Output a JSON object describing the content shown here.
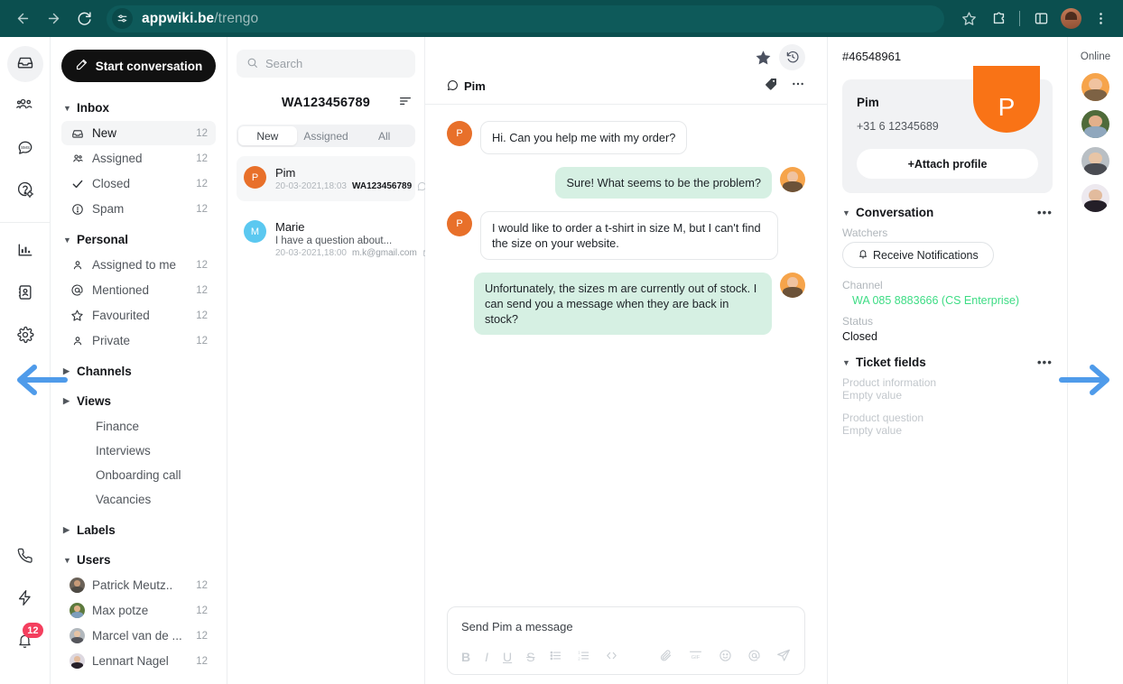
{
  "browser": {
    "url_host": "appwiki.be",
    "url_path": "/trengo",
    "back_icon": "back-arrow-icon",
    "forward_icon": "forward-arrow-icon",
    "reload_icon": "reload-icon",
    "site_settings_icon": "page-settings-icon",
    "bookmark_icon": "star-icon",
    "extensions_icon": "puzzle-icon",
    "sidepanel_icon": "side-panel-icon",
    "menu_icon": "three-dot-menu-icon"
  },
  "rail": {
    "items": [
      {
        "name": "inbox",
        "icon": "inbox-icon",
        "active": true
      },
      {
        "name": "teams",
        "icon": "users-group-icon",
        "active": false
      },
      {
        "name": "sms",
        "icon": "sms-bubble-icon",
        "active": false
      },
      {
        "name": "help-center",
        "icon": "help-gear-icon",
        "active": false
      },
      {
        "name": "reports",
        "icon": "bar-chart-icon",
        "active": false
      },
      {
        "name": "contacts",
        "icon": "contact-card-icon",
        "active": false
      },
      {
        "name": "settings",
        "icon": "gear-icon",
        "active": false
      }
    ],
    "bottom": [
      {
        "name": "voice",
        "icon": "phone-icon"
      },
      {
        "name": "automation",
        "icon": "lightning-bolt-icon"
      },
      {
        "name": "notifications",
        "icon": "bell-icon",
        "badge": "12"
      }
    ]
  },
  "sidebar": {
    "start_button": "Start conversation",
    "start_icon": "compose-pencil-icon",
    "sections": [
      {
        "title": "Inbox",
        "expanded": true,
        "items": [
          {
            "label": "New",
            "count": "12",
            "icon": "inbox-icon",
            "active": true
          },
          {
            "label": "Assigned",
            "count": "12",
            "icon": "users-group-icon",
            "active": false
          },
          {
            "label": "Closed",
            "count": "12",
            "icon": "check-icon",
            "active": false
          },
          {
            "label": "Spam",
            "count": "12",
            "icon": "exclamation-circle-icon",
            "active": false
          }
        ]
      },
      {
        "title": "Personal",
        "expanded": true,
        "items": [
          {
            "label": "Assigned to me",
            "count": "12",
            "icon": "user-icon",
            "active": false
          },
          {
            "label": "Mentioned",
            "count": "12",
            "icon": "at-icon",
            "active": false
          },
          {
            "label": "Favourited",
            "count": "12",
            "icon": "star-outline-icon",
            "active": false
          },
          {
            "label": "Private",
            "count": "12",
            "icon": "user-icon",
            "active": false
          }
        ]
      },
      {
        "title": "Channels",
        "expanded": false,
        "items": []
      },
      {
        "title": "Views",
        "expanded": false,
        "sub_items": [
          "Finance",
          "Interviews",
          "Onboarding call",
          "Vacancies"
        ]
      },
      {
        "title": "Labels",
        "expanded": false,
        "items": []
      },
      {
        "title": "Users",
        "expanded": true,
        "users": [
          {
            "label": "Patrick Meutz..",
            "count": "12",
            "color": "#6b6258"
          },
          {
            "label": "Max potze",
            "count": "12",
            "color": "#5d7a3e"
          },
          {
            "label": "Marcel van de ...",
            "count": "12",
            "color": "#9aa3ab"
          },
          {
            "label": "Lennart Nagel",
            "count": "12",
            "color": "#3a3540"
          }
        ]
      }
    ]
  },
  "conversations": {
    "search_placeholder": "Search",
    "search_icon": "search-icon",
    "title": "WA123456789",
    "sort_icon": "sort-icon",
    "tabs": [
      {
        "label": "New",
        "active": true
      },
      {
        "label": "Assigned",
        "active": false
      },
      {
        "label": "All",
        "active": false
      }
    ],
    "rows": [
      {
        "name": "Pim",
        "initial": "P",
        "avatar_color": "#e8702a",
        "preview": "",
        "time": "20-03-2021,18:03",
        "channel": "WA123456789",
        "channel_icon": "whatsapp-icon",
        "selected": true
      },
      {
        "name": "Marie",
        "initial": "M",
        "avatar_color": "#5bc8f0",
        "preview": "I have a question about...",
        "time": "20-03-2021,18:00",
        "channel": "m.k@gmail.com",
        "channel_icon": "mail-icon",
        "selected": false
      }
    ]
  },
  "chat": {
    "star_icon": "star-filled-icon",
    "history_icon": "history-revert-icon",
    "contact_name": "Pim",
    "contact_channel_icon": "whatsapp-icon",
    "label_icon": "tag-icon",
    "more_icon": "three-dot-menu-icon",
    "messages": [
      {
        "dir": "in",
        "text": "Hi. Can you help me with my order?",
        "initial": "P",
        "avatar_color": "#e8702a"
      },
      {
        "dir": "out",
        "text": "Sure! What seems to be the problem?",
        "avatar_type": "photo-woman"
      },
      {
        "dir": "in",
        "text": "I would like to order a t-shirt in size M, but I can't find the size on your website.",
        "initial": "P",
        "avatar_color": "#e8702a"
      },
      {
        "dir": "out",
        "text": "Unfortunately, the sizes m are currently out of stock. I can send you a message when they are back in stock?",
        "avatar_type": "photo-woman"
      }
    ],
    "composer": {
      "placeholder": "Send Pim a message",
      "tools_left": [
        {
          "name": "bold",
          "glyph": "B"
        },
        {
          "name": "italic",
          "glyph": "I"
        },
        {
          "name": "underline",
          "glyph": "U"
        },
        {
          "name": "strikethrough",
          "glyph": "S"
        },
        {
          "name": "bullet-list",
          "glyph": "bullet-list-icon"
        },
        {
          "name": "numbered-list",
          "glyph": "numbered-list-icon"
        },
        {
          "name": "code-block",
          "glyph": "code-icon"
        }
      ],
      "tools_right": [
        {
          "name": "attachment",
          "glyph": "paperclip-icon"
        },
        {
          "name": "gif",
          "glyph": "gif-icon"
        },
        {
          "name": "emoji",
          "glyph": "smiley-icon"
        },
        {
          "name": "mention",
          "glyph": "at-icon"
        },
        {
          "name": "send",
          "glyph": "send-icon"
        }
      ]
    }
  },
  "details": {
    "ticket_id": "#46548961",
    "profile": {
      "initial": "P",
      "name": "Pim",
      "phone": "+31 6 12345689",
      "attach_button": "+Attach profile"
    },
    "conversation_section": {
      "title": "Conversation",
      "more_icon": "three-dot-menu-icon",
      "watchers_label": "Watchers",
      "notifications_button": "Receive Notifications",
      "bell_icon": "bell-icon",
      "channel_label": "Channel",
      "channel_value": "WA 085 8883666 (CS Enterprise)",
      "status_label": "Status",
      "status_value": "Closed"
    },
    "ticket_fields": {
      "title": "Ticket fields",
      "more_icon": "three-dot-menu-icon",
      "fields": [
        {
          "label": "Product information",
          "value": "Empty value"
        },
        {
          "label": "Product question",
          "value": "Empty value"
        }
      ]
    }
  },
  "online": {
    "label": "Online",
    "avatars": [
      {
        "name": "agent-1",
        "bg": "#f6a44b",
        "hair": "#8a6239",
        "skin": "#f0c3a0"
      },
      {
        "name": "agent-2",
        "bg": "#4f6b3a",
        "hair": "#2c2219",
        "skin": "#e3b08b"
      },
      {
        "name": "agent-3",
        "bg": "#b9bfc4",
        "hair": "#3c3730",
        "skin": "#e8c5a6"
      },
      {
        "name": "agent-4",
        "bg": "#ede9ef",
        "hair": "#241f28",
        "skin": "#e2bb9d"
      }
    ]
  },
  "annotations": {
    "left_arrow": "left-arrow-annotation",
    "right_arrow": "right-arrow-annotation",
    "accent_color": "#4f9bea"
  }
}
